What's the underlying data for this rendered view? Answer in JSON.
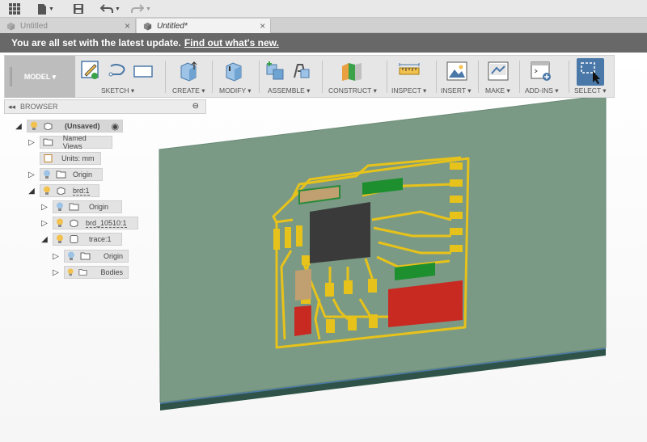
{
  "appbar": {
    "grid_icon": "app-grid-icon",
    "file_icon": "file-icon",
    "save_icon": "save-icon",
    "undo_icon": "undo-icon",
    "redo_icon": "redo-icon"
  },
  "tabs": [
    {
      "label": "Untitled",
      "active": false
    },
    {
      "label": "Untitled*",
      "active": true
    }
  ],
  "notification": {
    "text": "You are all set with the latest update.",
    "link": "Find out what's new."
  },
  "toolbar": {
    "workspace": "MODEL ▾",
    "groups": [
      {
        "label": "SKETCH ▾"
      },
      {
        "label": "CREATE ▾"
      },
      {
        "label": "MODIFY ▾"
      },
      {
        "label": "ASSEMBLE ▾"
      },
      {
        "label": "CONSTRUCT ▾"
      },
      {
        "label": "INSPECT ▾"
      },
      {
        "label": "INSERT ▾"
      },
      {
        "label": "MAKE ▾"
      },
      {
        "label": "ADD-INS ▾"
      },
      {
        "label": "SELECT ▾"
      }
    ]
  },
  "browser": {
    "title": "BROWSER",
    "items": [
      {
        "label": "(Unsaved)"
      },
      {
        "label": "Named Views"
      },
      {
        "label": "Units: mm"
      },
      {
        "label": "Origin"
      },
      {
        "label": "brd:1"
      },
      {
        "label": "Origin"
      },
      {
        "label": "brd_10510:1"
      },
      {
        "label": "trace:1"
      },
      {
        "label": "Origin"
      },
      {
        "label": "Bodies"
      }
    ]
  },
  "colors": {
    "board_top": "#7a9a85",
    "board_side": "#2f5348",
    "trace": "#e7c21a",
    "chip": "#3a3a3a",
    "red_component": "#c82a22",
    "green_component": "#1d8f2e",
    "tan_component": "#c0a070",
    "accent_blue": "#4a78a8"
  }
}
